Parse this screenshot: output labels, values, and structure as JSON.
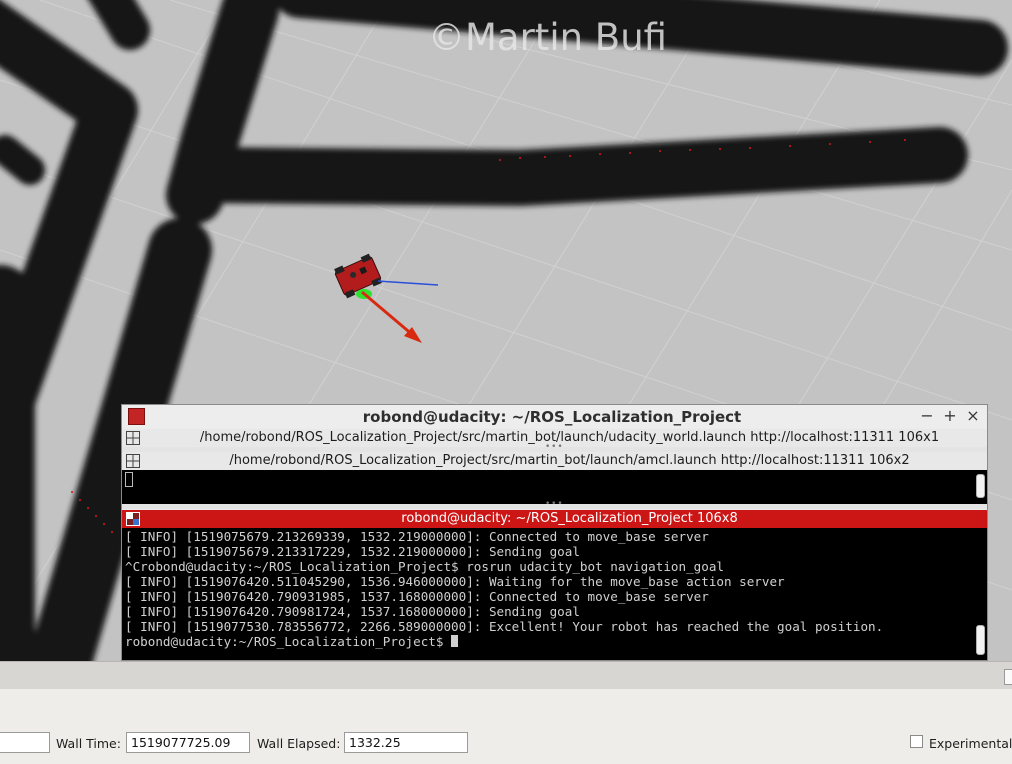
{
  "viewport": {
    "watermark": "©Martin Bufi"
  },
  "terminal": {
    "title": "robond@udacity: ~/ROS_Localization_Project",
    "controls": {
      "minimize": "−",
      "maximize": "+",
      "close": "×"
    },
    "panes": [
      {
        "header": "/home/robond/ROS_Localization_Project/src/martin_bot/launch/udacity_world.launch http://localhost:11311 106x1"
      },
      {
        "header": "/home/robond/ROS_Localization_Project/src/martin_bot/launch/amcl.launch http://localhost:11311 106x2"
      },
      {
        "header": "robond@udacity: ~/ROS_Localization_Project 106x8",
        "lines": [
          "[ INFO] [1519075679.213269339, 1532.219000000]: Connected to move_base server",
          "[ INFO] [1519075679.213317229, 1532.219000000]: Sending goal",
          "^Crobond@udacity:~/ROS_Localization_Project$ rosrun udacity_bot navigation_goal",
          "[ INFO] [1519076420.511045290, 1536.946000000]: Waiting for the move_base action server",
          "[ INFO] [1519076420.790931985, 1537.168000000]: Connected to move_base server",
          "[ INFO] [1519076420.790981724, 1537.168000000]: Sending goal",
          "[ INFO] [1519077530.783556772, 2266.589000000]: Excellent! Your robot has reached the goal position."
        ],
        "prompt": "robond@udacity:~/ROS_Localization_Project$ "
      }
    ]
  },
  "time_panel": {
    "wall_time_label": "Wall Time:",
    "wall_time_value": "1519077725.09",
    "wall_elapsed_label": "Wall Elapsed:",
    "wall_elapsed_value": "1332.25",
    "experimental_label": "Experimental"
  },
  "colors": {
    "map_free": "#c3c3c3",
    "map_obstacle": "#111111",
    "grid": "#d2d2d2",
    "active_pane": "#cc1616",
    "robot_body": "#b01c1c",
    "pose_arrow": "#e02810",
    "laser_points": "#d01010"
  }
}
